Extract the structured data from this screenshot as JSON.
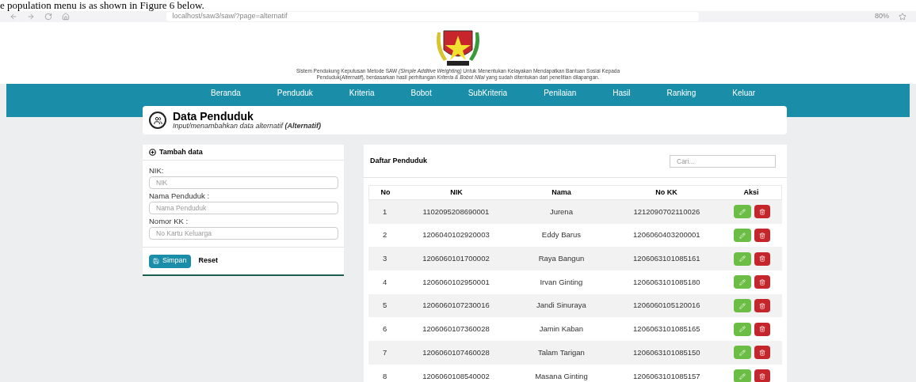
{
  "caption": "e population menu is as shown in Figure 6 below.",
  "browser": {
    "address": "localhost/saw3/saw/?page=alternatif",
    "zoom": "80%"
  },
  "header": {
    "description": "Sistem Pendukung Keputusan Metode SAW *(Simple Additive Weighting)* Untuk Menentukan Kelayakan Mendapatkan Bantuan Sosial Kepada Penduduk(*Alternatif*), berdasarkan hasil perhitungan *Kriteria & Bobot Nilai* yang sudah ditentukan dari penelitian dilapangan."
  },
  "nav": [
    "Beranda",
    "Penduduk",
    "Kriteria",
    "Bobot",
    "SubKriteria",
    "Penilaian",
    "Hasil",
    "Ranking",
    "Keluar"
  ],
  "page": {
    "title": "Data Penduduk",
    "subtitle": "Input/menambahkan data alternatif **(Alternatif)**"
  },
  "form": {
    "title": "Tambah data",
    "fields": [
      {
        "label": "NIK:",
        "placeholder": "NIK"
      },
      {
        "label": "Nama Penduduk :",
        "placeholder": "Nama Penduduk"
      },
      {
        "label": "Nomor KK :",
        "placeholder": "No Kartu Keluarga"
      }
    ],
    "save": "Simpan",
    "reset": "Reset"
  },
  "list": {
    "title": "Daftar Penduduk",
    "search_placeholder": "Cari...",
    "columns": [
      "No",
      "NIK",
      "Nama",
      "No KK",
      "Aksi"
    ],
    "rows": [
      [
        "1",
        "1102095208690001",
        "Jurena",
        "1212090702110026"
      ],
      [
        "2",
        "1206040102920003",
        "Eddy Barus",
        "1206060403200001"
      ],
      [
        "3",
        "1206060101700002",
        "Raya Bangun",
        "1206063101085161"
      ],
      [
        "4",
        "1206060102950001",
        "Irvan Ginting",
        "1206063101085180"
      ],
      [
        "5",
        "1206060107230016",
        "Jandi Sinuraya",
        "1206060105120016"
      ],
      [
        "6",
        "1206060107360028",
        "Jamin Kaban",
        "1206063101085165"
      ],
      [
        "7",
        "1206060107460028",
        "Talam Tarigan",
        "1206063101085150"
      ],
      [
        "8",
        "1206060108540002",
        "Masana Ginting",
        "1206063101085157"
      ]
    ]
  }
}
